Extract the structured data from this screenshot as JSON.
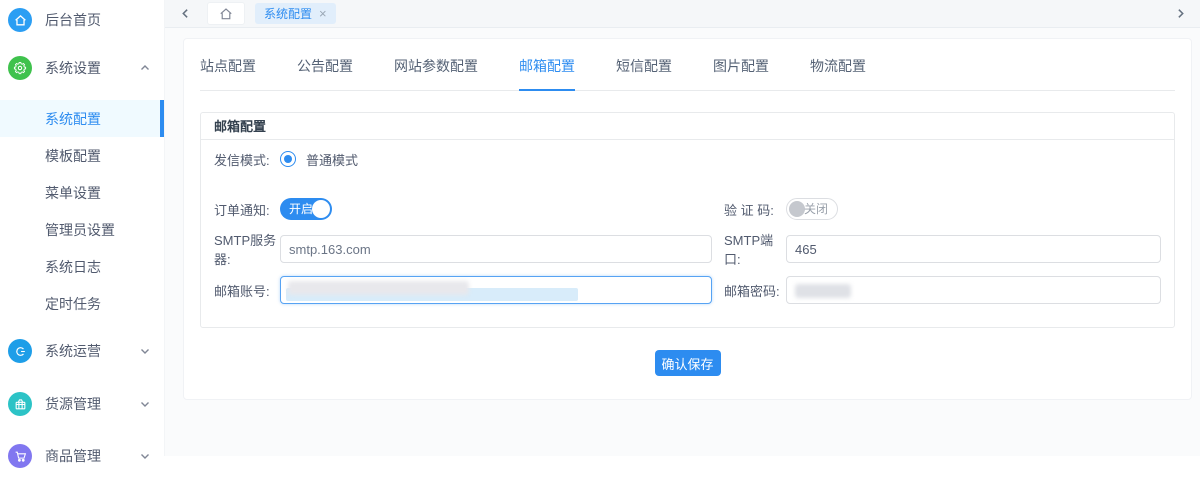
{
  "colors": {
    "primary": "#2d8cf0",
    "home_icon_bg": "#2b9ef3",
    "gear_icon_bg": "#3fc24d",
    "operations_icon_bg": "#1e9ee8",
    "supply_icon_bg": "#2cc3c6",
    "goods_icon_bg": "#8177f0",
    "switch_on": "#2d8cf0",
    "tag_active_bg": "#e1eefb"
  },
  "sidebar": {
    "items": [
      {
        "label": "后台首页",
        "icon": "home-icon"
      },
      {
        "label": "系统设置",
        "icon": "gear-icon",
        "state": "expanded"
      },
      {
        "label": "系统配置",
        "active": true
      },
      {
        "label": "模板配置"
      },
      {
        "label": "菜单设置"
      },
      {
        "label": "管理员设置"
      },
      {
        "label": "系统日志"
      },
      {
        "label": "定时任务"
      },
      {
        "label": "系统运营",
        "icon": "operations-icon",
        "state": "collapsed"
      },
      {
        "label": "货源管理",
        "icon": "supply-icon",
        "state": "collapsed"
      },
      {
        "label": "商品管理",
        "icon": "goods-icon",
        "state": "collapsed"
      }
    ]
  },
  "tagbar": {
    "active_tag": "系统配置",
    "close_glyph": "×"
  },
  "tabs": {
    "items": [
      "站点配置",
      "公告配置",
      "网站参数配置",
      "邮箱配置",
      "短信配置",
      "图片配置",
      "物流配置"
    ],
    "active": "邮箱配置"
  },
  "panel": {
    "title": "邮箱配置",
    "send_mode": {
      "label": "发信模式:",
      "option": "普通模式",
      "selected": true
    },
    "order_notify": {
      "label": "订单通知:",
      "switch_text": "开启",
      "state": "on"
    },
    "captcha": {
      "label": "验 证 码:",
      "switch_text": "关闭",
      "state": "off"
    },
    "smtp_server": {
      "label": "SMTP服务器:",
      "value": "smtp.163.com"
    },
    "smtp_port": {
      "label": "SMTP端口:",
      "value": "465"
    },
    "email_account": {
      "label": "邮箱账号:",
      "value": "",
      "redacted": true,
      "focused": true
    },
    "email_password": {
      "label": "邮箱密码:",
      "value": "",
      "redacted": true
    }
  },
  "save_button": "确认保存"
}
